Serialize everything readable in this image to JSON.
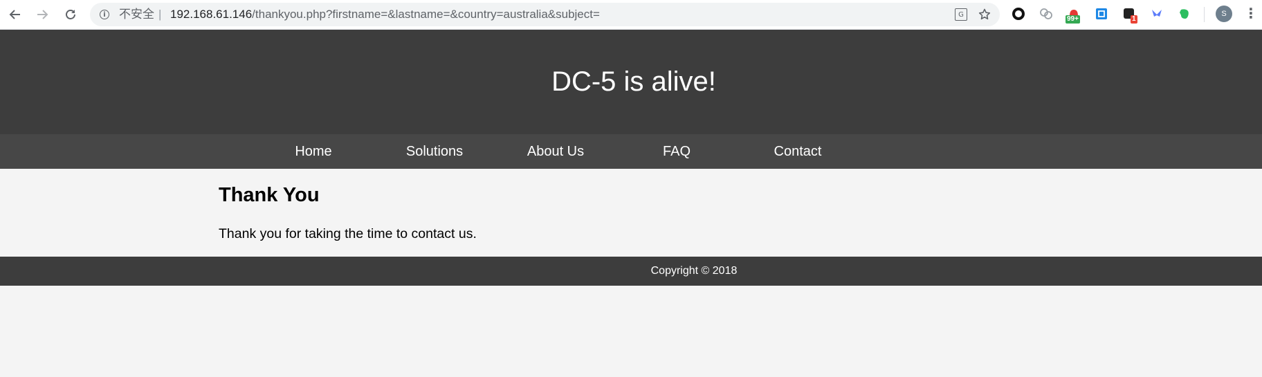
{
  "browser": {
    "security_label": "不安全",
    "separator": "|",
    "url_host": "192.168.61.146",
    "url_path": "/thankyou.php?firstname=&lastname=&country=australia&subject=",
    "extensions": {
      "badge_1": "99+",
      "badge_2": "1",
      "profile_initial": "S"
    },
    "colors": {
      "badge_green": "#34a853",
      "badge_red": "#ea4335"
    }
  },
  "site": {
    "title": "DC-5 is alive!",
    "nav": [
      "Home",
      "Solutions",
      "About Us",
      "FAQ",
      "Contact"
    ],
    "content": {
      "heading": "Thank You",
      "text": "Thank you for taking the time to contact us."
    },
    "footer": "Copyright © 2018",
    "colors": {
      "header_bg": "#3d3d3d",
      "nav_bg": "#474747",
      "page_bg": "#f4f4f4"
    }
  }
}
